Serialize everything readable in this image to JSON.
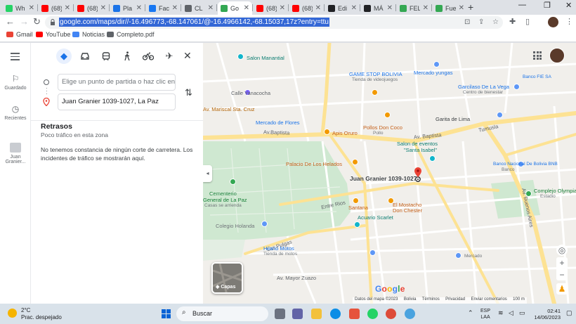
{
  "browser": {
    "tabs": [
      {
        "label": "Wh",
        "fav_color": "#25d366"
      },
      {
        "label": "(68)",
        "fav_color": "#ff0000"
      },
      {
        "label": "(68)",
        "fav_color": "#ff0000"
      },
      {
        "label": "Pla",
        "fav_color": "#1a73e8"
      },
      {
        "label": "Fac",
        "fav_color": "#1877f2"
      },
      {
        "label": "CL",
        "fav_color": "#5f6368"
      },
      {
        "label": "Go",
        "fav_color": "#34a853"
      },
      {
        "label": "(68)",
        "fav_color": "#ff0000"
      },
      {
        "label": "(68)",
        "fav_color": "#ff0000"
      },
      {
        "label": "Edi",
        "fav_color": "#202124"
      },
      {
        "label": "MÁ",
        "fav_color": "#202124"
      },
      {
        "label": "FEL",
        "fav_color": "#34a853"
      },
      {
        "label": "Fue",
        "fav_color": "#34a853"
      }
    ],
    "url": "google.com/maps/dir//-16.496773,-68.147061/@-16.4966142,-68.15037,17z?entry=ttu",
    "bookmarks": [
      "Gmail",
      "YouTube",
      "Noticias",
      "Completo.pdf"
    ]
  },
  "sidebar": {
    "saved_label": "Guardado",
    "recent_label": "Recientes",
    "recent_place": "Juan Granier..."
  },
  "directions": {
    "modes": [
      "best-route",
      "driving",
      "transit",
      "walking",
      "cycling",
      "flights"
    ],
    "active_mode": "best-route",
    "origin_placeholder": "Elige un punto de partida o haz clic en el mapa...",
    "destination_value": "Juan Granier 1039-1027, La Paz"
  },
  "delays": {
    "title": "Retrasos",
    "subtitle": "Poco tráfico en esta zona",
    "message": "No tenemos constancia de ningún corte de carretera. Los incidentes de tráfico se mostrarán aquí."
  },
  "map": {
    "destination_label": "Juan Granier 1039-1027",
    "labels": {
      "salon_manantial": "Salon Manantial",
      "game_stop": "GAME STOP BOLIVIA",
      "game_stop_sub": "Tienda de videojuegos",
      "mercado_yungas": "Mercado yungas",
      "fie": "Banco FIE SA",
      "garcilaso": "Garcilaso De La Vega",
      "garcilaso_sub": "Centro de bienestar",
      "c_yanacocha": "Calle Yanacocha",
      "av_mariscal": "Av. Mariscal Sta. Cruz",
      "mercado_flores": "Mercado de Flores",
      "pollos": "Pollos Don Coco",
      "pollos_sub": "Pollo",
      "apis": "Apis Oruro",
      "av_baptista": "Av.Baptista",
      "av_baptista2": "Av. Baptista",
      "garita": "Garita de Lima",
      "tumusla": "Tumusla",
      "salon_eventos": "Salon de eventos",
      "santa_isabel": "\"Santa Isabel\"",
      "bnb": "Banco Nacional De Bolivia BNB",
      "bnb_sub": "Banco",
      "palacio": "Palacio De Los Helados",
      "cementerio": "Cementerio",
      "cementerio_sub": "General de La Paz",
      "cementerio_sub2": "Casas se arrienda",
      "entre_rios": "Entre Rios",
      "santana": "Santana",
      "chester": "El Mostacho",
      "chester2": "Don Chester",
      "acuario": "Acuario Scarlet",
      "colegio": "Colegio Holanda",
      "las_pulgas": "Las Pulgas",
      "hilario": "Hilario Motos",
      "hilario_sub": "Tienda de motos",
      "mercado_sub": "Mercado",
      "av_buenos_aires": "Av. Buenos Aires",
      "complejo": "Complejo Olympia",
      "complejo_sub": "Estadio",
      "mayor": "Av. Mayor Zuazo",
      "capas": "Capas",
      "google": "Google"
    },
    "attribution": [
      "Datos del mapa ©2023",
      "Bolivia",
      "Términos",
      "Privacidad",
      "Enviar comentarios",
      "100 m"
    ]
  },
  "taskbar": {
    "temp": "2°C",
    "weather": "Prac. despejado",
    "search": "Buscar",
    "lang1": "ESP",
    "lang2": "LAA",
    "time": "02:41",
    "date": "14/06/2023"
  },
  "colors": {
    "accent": "#1a73e8",
    "pin_red": "#ea4335",
    "park_green": "#c8e6c9",
    "road_yellow": "#fde293"
  }
}
